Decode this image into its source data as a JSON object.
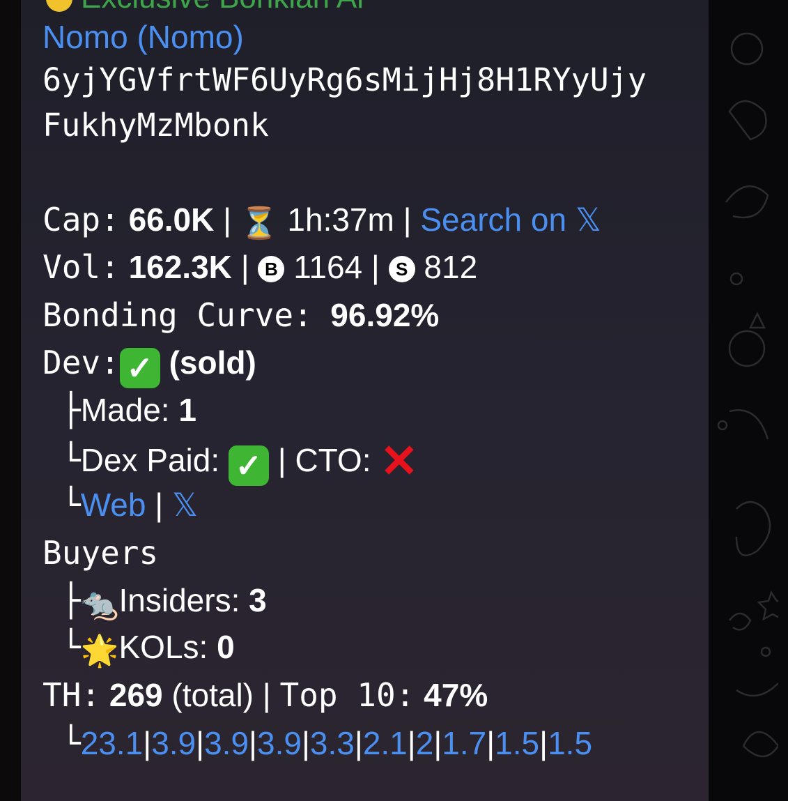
{
  "top": {
    "channel_name": "Exclusive Bonkian Al"
  },
  "token": {
    "name_link": "Nomo (Nomo)",
    "address_line1": "6yjYGVfrtWF6UyRg6sMijHj8H1RYyUjy",
    "address_line2": "FukhyMzMbonk"
  },
  "cap": {
    "label": "Cap:",
    "value": "66.0K",
    "sep": "|",
    "age": "1h:37m",
    "sep2": "|",
    "search_link": "Search on",
    "x_glyph": "𝕏"
  },
  "vol": {
    "label": "Vol:",
    "value": "162.3K",
    "sep": "|",
    "buys_badge": "B",
    "buys": "1164",
    "sep2": "|",
    "sells_badge": "S",
    "sells": "812"
  },
  "bonding": {
    "label": "Bonding Curve:",
    "value": "96.92%"
  },
  "dev": {
    "label": "Dev:",
    "status": "(sold)",
    "made_prefix": "├",
    "made_label": "Made:",
    "made_value": "1",
    "dex_prefix": "└",
    "dex_label": "Dex Paid:",
    "cto_sep": "|",
    "cto_label": "CTO:",
    "links_prefix": "└",
    "web_link": "Web",
    "links_sep": "|",
    "x_link": "𝕏"
  },
  "buyers": {
    "label": "Buyers",
    "insiders_prefix": "├",
    "insiders_label": "Insiders:",
    "insiders_value": "3",
    "kols_prefix": "└",
    "kols_label": "KOLs:",
    "kols_value": "0"
  },
  "holders": {
    "label": "TH:",
    "total": "269",
    "total_suffix": "(total)",
    "sep": "|",
    "top_label": "Top 10:",
    "top_value": "47%",
    "list_prefix": "└",
    "top_holders": [
      "23.1",
      "3.9",
      "3.9",
      "3.9",
      "3.3",
      "2.1",
      "2",
      "1.7",
      "1.5",
      "1.5"
    ]
  },
  "colors": {
    "link": "#4b8ff1",
    "check_green": "#3fb534",
    "cross_red": "#e8121c",
    "bubble": "#25232e"
  }
}
